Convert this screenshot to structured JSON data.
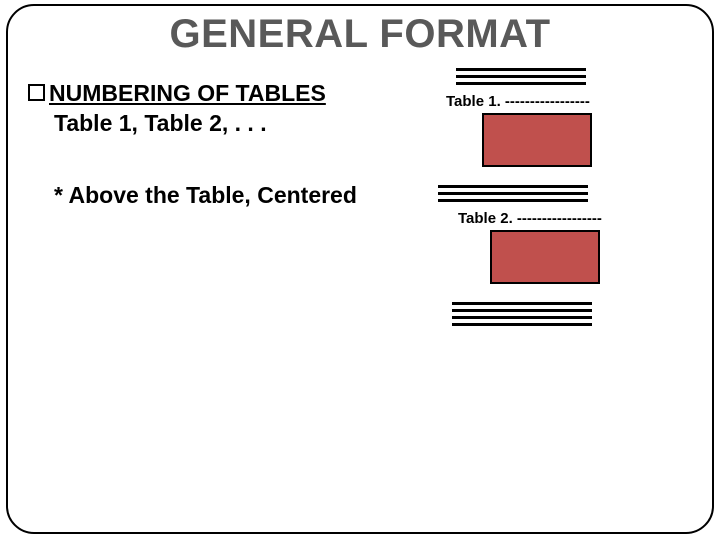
{
  "title": "GENERAL FORMAT",
  "left": {
    "heading": "NUMBERING OF TABLES",
    "sub": "Table 1, Table 2, . . .",
    "note": "* Above the Table, Centered"
  },
  "right": {
    "caption1": "Table 1. -----------------",
    "caption2": "Table 2. -----------------"
  }
}
